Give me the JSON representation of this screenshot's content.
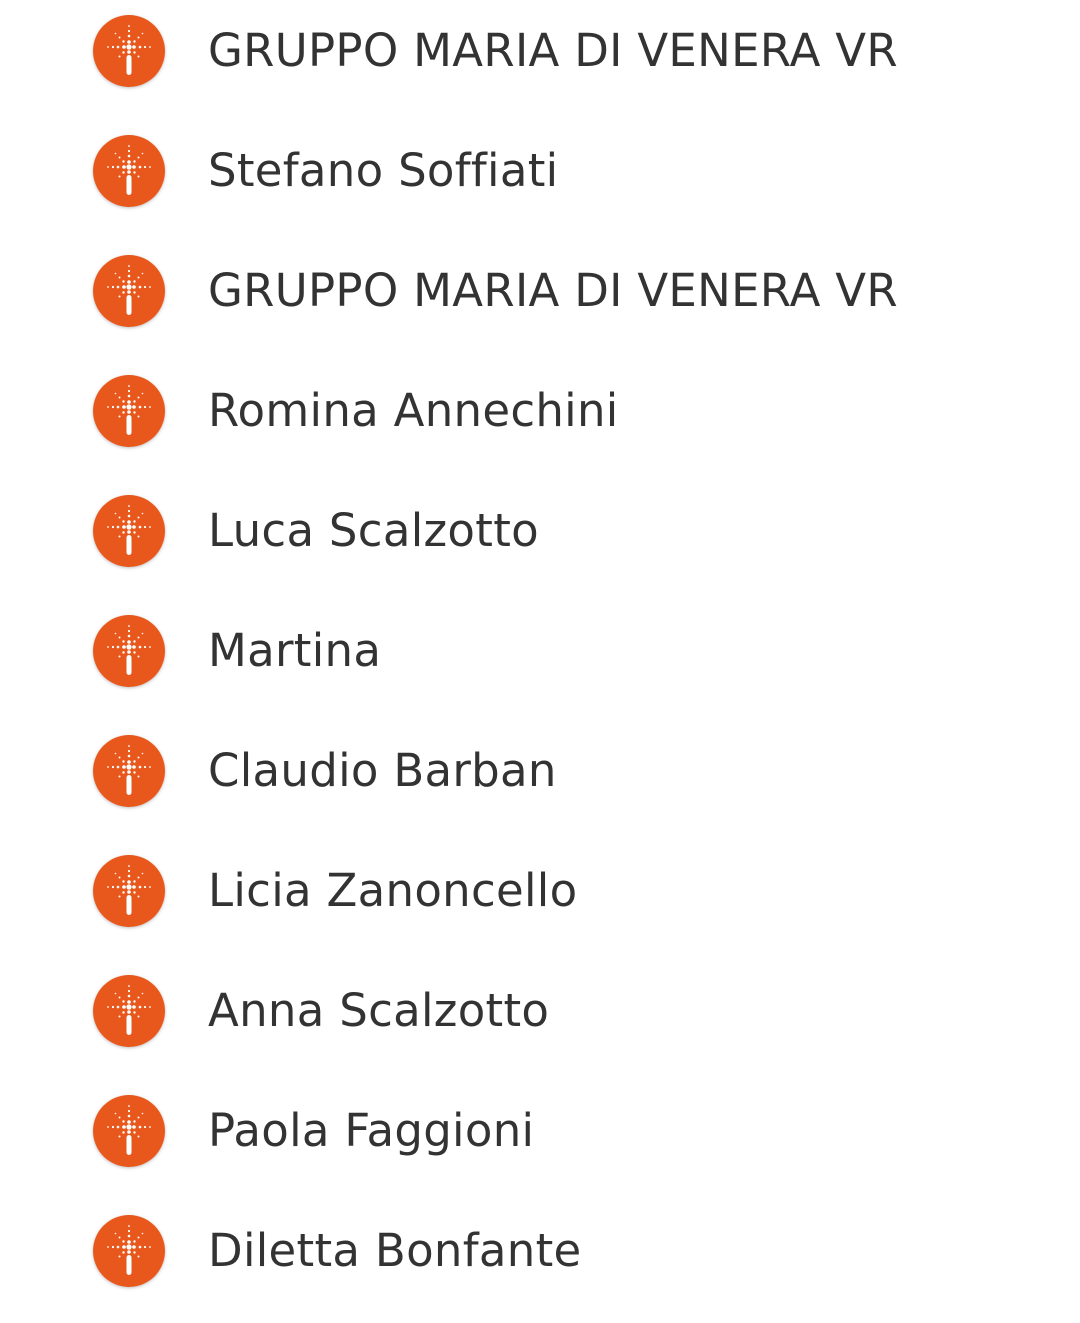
{
  "colors": {
    "avatar_bg": "#e8581c",
    "avatar_glyph": "#ffffff",
    "text": "#333333",
    "background": "#ffffff"
  },
  "avatar_icon": "sparkle-candle-icon",
  "contacts": [
    {
      "name": "GRUPPO MARIA DI VENERA VR"
    },
    {
      "name": "Stefano Soffiati"
    },
    {
      "name": "GRUPPO MARIA DI VENERA VR"
    },
    {
      "name": "Romina Annechini"
    },
    {
      "name": "Luca Scalzotto"
    },
    {
      "name": "Martina"
    },
    {
      "name": "Claudio Barban"
    },
    {
      "name": "Licia Zanoncello"
    },
    {
      "name": "Anna Scalzotto"
    },
    {
      "name": "Paola Faggioni"
    },
    {
      "name": "Diletta Bonfante"
    }
  ]
}
